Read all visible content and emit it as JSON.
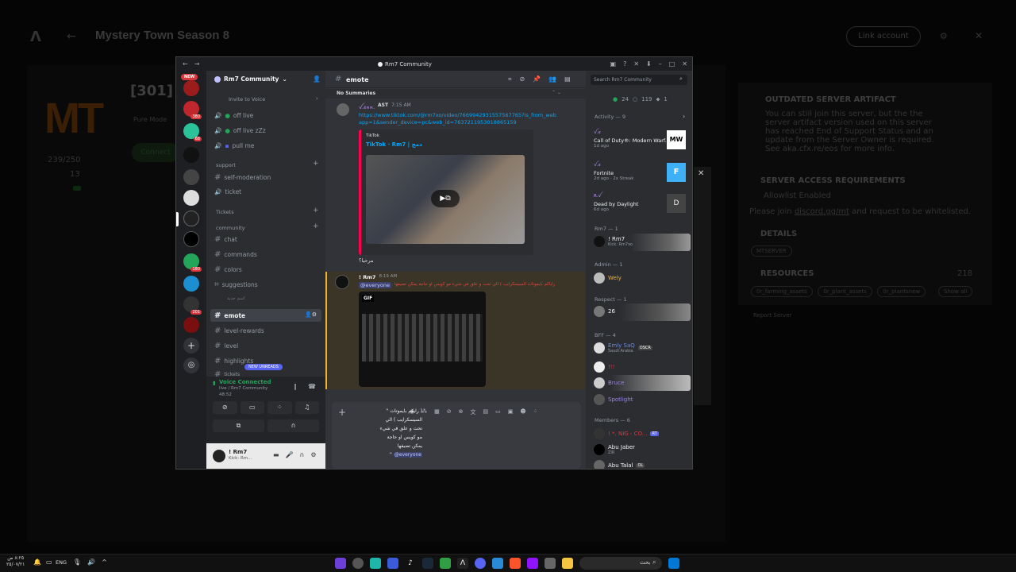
{
  "background": {
    "title": "Mystery Town Season 8",
    "link_account": "Link account",
    "logo": "MT",
    "server_code": "[301]",
    "pure_mode": "Pure Mode",
    "connect": "Connect",
    "players": "239/250",
    "count": "13",
    "outdated_title": "OUTDATED SERVER ARTIFACT",
    "outdated_text": "You can still join this server, but the the server artifact version used on this server has reached End of Support Status and an update from the Server Owner is required. See aka.cfx.re/eos for more info.",
    "access_title": "SERVER ACCESS REQUIREMENTS",
    "allowlist": "Allowlist Enabled",
    "join_text_pre": "Please join ",
    "join_link": "discord.gg/mt",
    "join_text_post": " and request to be whitelisted.",
    "details_title": "DETAILS",
    "mtserver": "MTSERVER",
    "resources_title": "RESOURCES",
    "resources_count": "218",
    "res_tags": [
      "0r_farming_assets",
      "0r_plant_assets",
      "0r_plantsnew"
    ],
    "show_all": "Show all",
    "report": "Report Server"
  },
  "discord": {
    "window_title": "Rm7 Community",
    "new_badge": "NEW",
    "guild_badges": [
      "380",
      "68",
      "180",
      "201"
    ],
    "server_name": "Rm7 Community",
    "invite_to_voice": "Invite to Voice",
    "voice_channels": [
      "off live",
      "off live zZz",
      "pull me"
    ],
    "categories": {
      "support": "support",
      "tickets": "Tickets",
      "community": "community"
    },
    "support_channels": [
      "self-moderation",
      "ticket"
    ],
    "community_channels": [
      "chat",
      "commands",
      "colors",
      "suggestions"
    ],
    "arabic_sub": "اسم جديد",
    "selected_channel": "emote",
    "after_channels": [
      "level-rewards",
      "level",
      "highlights",
      "tickets"
    ],
    "new_unreads": "NEW UNREADS",
    "voice_connected": "Voice Connected",
    "voice_path": "live / Rm7 Community",
    "voice_time": "48:52",
    "user_name": "! Rm7",
    "user_status": "Kick: Rm...",
    "chat_header": "emote",
    "no_summaries": "No Summaries",
    "search_placeholder": "Search Rm7 Community",
    "msg1_author": "ꪜ.ꫀꪀꪀ.",
    "msg1_time": "7:15 AM",
    "msg1_tag": "AST",
    "msg1_link": "https://www.tiktok.com/@rm7xo/video/7669942931557567765?is_from_webapp=1&sender_device=pc&web_id=7637211953018865159",
    "embed_provider": "TikTok",
    "embed_title": "TikTok · Rm7 | دمج",
    "msg1_reply": "مرحبا؟",
    "msg2_author": "! Rm7",
    "msg2_time": "8:19 AM",
    "msg2_mention": "@everyone",
    "msg2_text": "راياكم بايموتات السيسكرايب ) الي تحت و علق في شيء مو كويس او حاجة يمكن تضيفها",
    "gif_label": "GIF",
    "composer_lines": [
      "'' رايكم بايموتات )",
      "السيسكرايب ) الي",
      "تحت و علق في شيء",
      "مو كويس او حاجة",
      "يمكن تضيفها"
    ],
    "composer_mention": "@everyone",
    "composer_quote": "''",
    "stats": {
      "online": "24",
      "idle": "119",
      "other": "1"
    },
    "activity_label": "Activity — 9",
    "activities": [
      {
        "user": "ꪜ.ꫀ",
        "game": "Call of Duty®: Modern Warf...",
        "time": "1d ago",
        "icon": "MW"
      },
      {
        "user": "ꪜ.ꫀ",
        "game": "Fortnite",
        "time": "2d ago",
        "extra": "2x Streak",
        "icon": "F"
      },
      {
        "user": "R.ꪜ",
        "game": "Dead by Daylight",
        "time": "6d ago",
        "icon": "D"
      }
    ],
    "groups": [
      {
        "label": "Rm7 — 1",
        "members": [
          {
            "name": "! Rm7",
            "sub": "Kick: Rm7xo"
          }
        ]
      },
      {
        "label": "Admin — 1",
        "members": [
          {
            "name": "Wely",
            "sub": ""
          }
        ]
      },
      {
        "label": "Respect — 1",
        "members": [
          {
            "name": "26",
            "sub": ""
          }
        ]
      },
      {
        "label": "BFF — 4",
        "members": [
          {
            "name": "Emly SaQ",
            "sub": "Saudi Arabia",
            "badge": "OSCR"
          },
          {
            "name": "!!!",
            "sub": ""
          },
          {
            "name": "Bruce",
            "sub": ""
          },
          {
            "name": "Spotlight",
            "sub": ""
          }
        ]
      },
      {
        "label": "Members — 6",
        "members": [
          {
            "name": "! *. NIG - CO...",
            "sub": "",
            "badge": "RT"
          },
          {
            "name": "Abu Jaber",
            "sub": "ZIR"
          },
          {
            "name": "Abu Talal",
            "sub": "",
            "badge": "OL"
          }
        ]
      }
    ]
  },
  "taskbar": {
    "lang": "ENG",
    "time": "٨:٢٥ ص",
    "date": "٢٥/٠٧/٢١",
    "search": "بحث"
  }
}
